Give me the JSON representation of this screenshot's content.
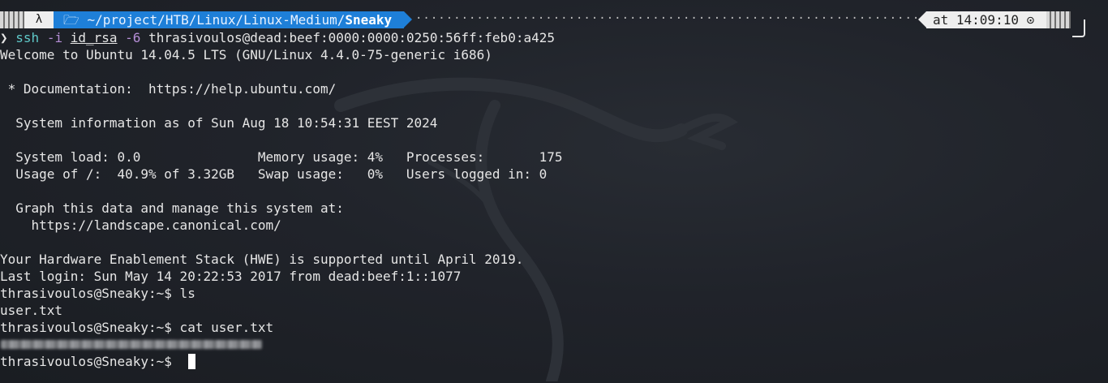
{
  "prompt_bar": {
    "os_icon": "linux-penguin-icon",
    "folder_icon": "folder-icon",
    "path_prefix": "~/project/HTB/Linux/Linux-Medium/",
    "path_last": "Sneaky",
    "time_text": "at 14:09:10",
    "clock_icon": "clock-icon"
  },
  "terminal": {
    "prompt_symbol": "❯",
    "ssh_cmd": "ssh",
    "ssh_flag_i": "-i",
    "ssh_key": "id_rsa",
    "ssh_flag_6": "-6",
    "ssh_target": "thrasivoulos@dead:beef:0000:0000:0250:56ff:feb0:a425",
    "lines": [
      "Welcome to Ubuntu 14.04.5 LTS (GNU/Linux 4.4.0-75-generic i686)",
      "",
      " * Documentation:  https://help.ubuntu.com/",
      "",
      "  System information as of Sun Aug 18 10:54:31 EEST 2024",
      "",
      "  System load: 0.0               Memory usage: 4%   Processes:       175",
      "  Usage of /:  40.9% of 3.32GB   Swap usage:   0%   Users logged in: 0",
      "",
      "  Graph this data and manage this system at:",
      "    https://landscape.canonical.com/",
      "",
      "Your Hardware Enablement Stack (HWE) is supported until April 2019.",
      "Last login: Sun May 14 20:22:53 2017 from dead:beef:1::1077",
      "thrasivoulos@Sneaky:~$ ls",
      "user.txt",
      "thrasivoulos@Sneaky:~$ cat user.txt"
    ],
    "final_prompt": "thrasivoulos@Sneaky:~$ "
  },
  "background_icon": "kali-dragon-icon"
}
